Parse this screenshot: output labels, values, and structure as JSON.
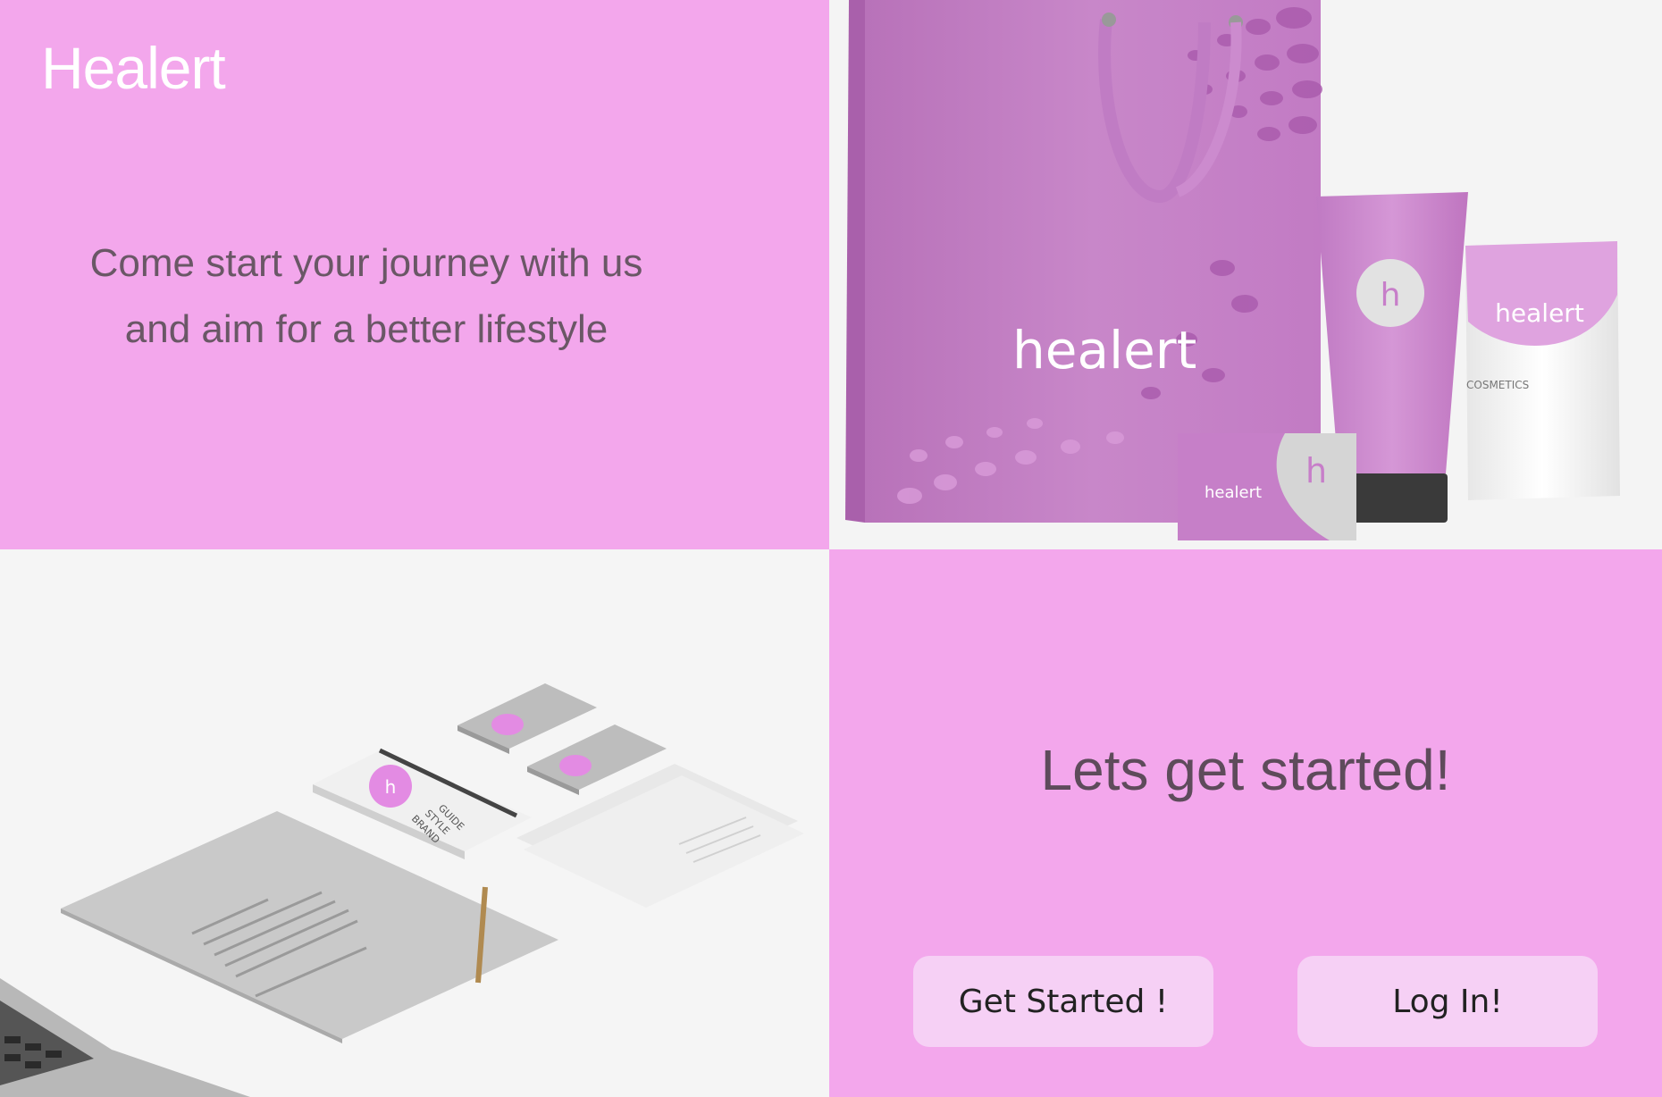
{
  "brand": {
    "title": "Healert"
  },
  "hero": {
    "tagline_line1": "Come start your journey with us",
    "tagline_line2": "and aim for a better lifestyle"
  },
  "product_photo": {
    "bag_label": "healert",
    "tube_letter": "h",
    "pouch_label": "healert",
    "pouch_sub": "COSMETICS",
    "card_label": "healert",
    "card_letter": "h"
  },
  "stationery_photo": {
    "logo_letter": "h",
    "guide_text_1": "BRAND",
    "guide_text_2": "STYLE",
    "guide_text_3": "GUIDE"
  },
  "cta": {
    "title": "Lets get started!",
    "get_started_label": "Get Started !",
    "login_label": "Log In!"
  },
  "colors": {
    "pink": "#f3a7ec",
    "button": "#f6d0f5",
    "text_dark": "#5e4b5b",
    "magenta": "#c57fc7"
  }
}
